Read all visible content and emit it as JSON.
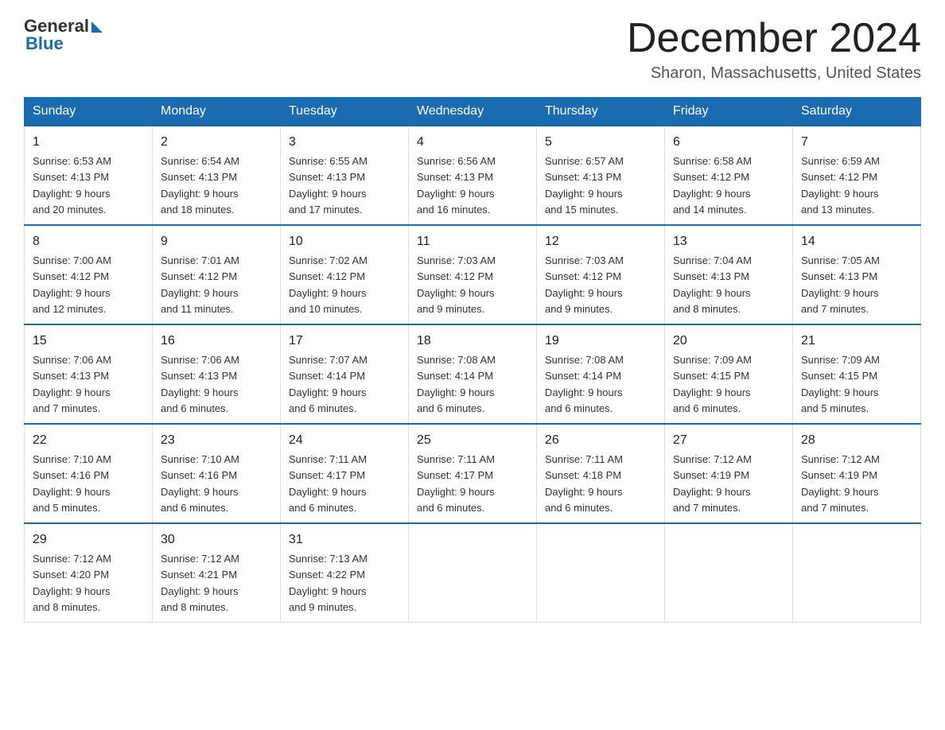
{
  "header": {
    "logo_general": "General",
    "logo_blue": "Blue",
    "month_title": "December 2024",
    "location": "Sharon, Massachusetts, United States"
  },
  "weekdays": [
    "Sunday",
    "Monday",
    "Tuesday",
    "Wednesday",
    "Thursday",
    "Friday",
    "Saturday"
  ],
  "weeks": [
    [
      {
        "day": "1",
        "sunrise": "6:53 AM",
        "sunset": "4:13 PM",
        "daylight": "9 hours and 20 minutes."
      },
      {
        "day": "2",
        "sunrise": "6:54 AM",
        "sunset": "4:13 PM",
        "daylight": "9 hours and 18 minutes."
      },
      {
        "day": "3",
        "sunrise": "6:55 AM",
        "sunset": "4:13 PM",
        "daylight": "9 hours and 17 minutes."
      },
      {
        "day": "4",
        "sunrise": "6:56 AM",
        "sunset": "4:13 PM",
        "daylight": "9 hours and 16 minutes."
      },
      {
        "day": "5",
        "sunrise": "6:57 AM",
        "sunset": "4:13 PM",
        "daylight": "9 hours and 15 minutes."
      },
      {
        "day": "6",
        "sunrise": "6:58 AM",
        "sunset": "4:12 PM",
        "daylight": "9 hours and 14 minutes."
      },
      {
        "day": "7",
        "sunrise": "6:59 AM",
        "sunset": "4:12 PM",
        "daylight": "9 hours and 13 minutes."
      }
    ],
    [
      {
        "day": "8",
        "sunrise": "7:00 AM",
        "sunset": "4:12 PM",
        "daylight": "9 hours and 12 minutes."
      },
      {
        "day": "9",
        "sunrise": "7:01 AM",
        "sunset": "4:12 PM",
        "daylight": "9 hours and 11 minutes."
      },
      {
        "day": "10",
        "sunrise": "7:02 AM",
        "sunset": "4:12 PM",
        "daylight": "9 hours and 10 minutes."
      },
      {
        "day": "11",
        "sunrise": "7:03 AM",
        "sunset": "4:12 PM",
        "daylight": "9 hours and 9 minutes."
      },
      {
        "day": "12",
        "sunrise": "7:03 AM",
        "sunset": "4:12 PM",
        "daylight": "9 hours and 9 minutes."
      },
      {
        "day": "13",
        "sunrise": "7:04 AM",
        "sunset": "4:13 PM",
        "daylight": "9 hours and 8 minutes."
      },
      {
        "day": "14",
        "sunrise": "7:05 AM",
        "sunset": "4:13 PM",
        "daylight": "9 hours and 7 minutes."
      }
    ],
    [
      {
        "day": "15",
        "sunrise": "7:06 AM",
        "sunset": "4:13 PM",
        "daylight": "9 hours and 7 minutes."
      },
      {
        "day": "16",
        "sunrise": "7:06 AM",
        "sunset": "4:13 PM",
        "daylight": "9 hours and 6 minutes."
      },
      {
        "day": "17",
        "sunrise": "7:07 AM",
        "sunset": "4:14 PM",
        "daylight": "9 hours and 6 minutes."
      },
      {
        "day": "18",
        "sunrise": "7:08 AM",
        "sunset": "4:14 PM",
        "daylight": "9 hours and 6 minutes."
      },
      {
        "day": "19",
        "sunrise": "7:08 AM",
        "sunset": "4:14 PM",
        "daylight": "9 hours and 6 minutes."
      },
      {
        "day": "20",
        "sunrise": "7:09 AM",
        "sunset": "4:15 PM",
        "daylight": "9 hours and 6 minutes."
      },
      {
        "day": "21",
        "sunrise": "7:09 AM",
        "sunset": "4:15 PM",
        "daylight": "9 hours and 5 minutes."
      }
    ],
    [
      {
        "day": "22",
        "sunrise": "7:10 AM",
        "sunset": "4:16 PM",
        "daylight": "9 hours and 5 minutes."
      },
      {
        "day": "23",
        "sunrise": "7:10 AM",
        "sunset": "4:16 PM",
        "daylight": "9 hours and 6 minutes."
      },
      {
        "day": "24",
        "sunrise": "7:11 AM",
        "sunset": "4:17 PM",
        "daylight": "9 hours and 6 minutes."
      },
      {
        "day": "25",
        "sunrise": "7:11 AM",
        "sunset": "4:17 PM",
        "daylight": "9 hours and 6 minutes."
      },
      {
        "day": "26",
        "sunrise": "7:11 AM",
        "sunset": "4:18 PM",
        "daylight": "9 hours and 6 minutes."
      },
      {
        "day": "27",
        "sunrise": "7:12 AM",
        "sunset": "4:19 PM",
        "daylight": "9 hours and 7 minutes."
      },
      {
        "day": "28",
        "sunrise": "7:12 AM",
        "sunset": "4:19 PM",
        "daylight": "9 hours and 7 minutes."
      }
    ],
    [
      {
        "day": "29",
        "sunrise": "7:12 AM",
        "sunset": "4:20 PM",
        "daylight": "9 hours and 8 minutes."
      },
      {
        "day": "30",
        "sunrise": "7:12 AM",
        "sunset": "4:21 PM",
        "daylight": "9 hours and 8 minutes."
      },
      {
        "day": "31",
        "sunrise": "7:13 AM",
        "sunset": "4:22 PM",
        "daylight": "9 hours and 9 minutes."
      },
      null,
      null,
      null,
      null
    ]
  ],
  "labels": {
    "sunrise": "Sunrise:",
    "sunset": "Sunset:",
    "daylight": "Daylight: 9 hours"
  }
}
